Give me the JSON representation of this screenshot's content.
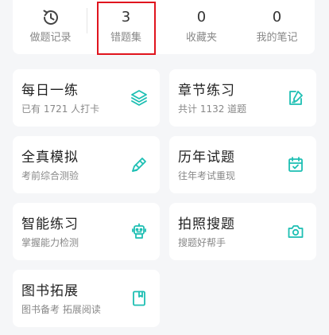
{
  "stats": {
    "record": {
      "label": "做题记录",
      "icon": "history-clock-icon"
    },
    "wrong": {
      "count": "3",
      "label": "错题集"
    },
    "favorites": {
      "count": "0",
      "label": "收藏夹"
    },
    "notes": {
      "count": "0",
      "label": "我的笔记"
    }
  },
  "tiles": [
    {
      "title": "每日一练",
      "subtitle": "已有 1721 人打卡",
      "icon": "layers-icon"
    },
    {
      "title": "章节练习",
      "subtitle": "共计 1132 道题",
      "icon": "edit-note-icon"
    },
    {
      "title": "全真模拟",
      "subtitle": "考前综合测验",
      "icon": "pencil-eraser-icon"
    },
    {
      "title": "历年试题",
      "subtitle": "往年考试重现",
      "icon": "calendar-check-icon"
    },
    {
      "title": "智能练习",
      "subtitle": "掌握能力检测",
      "icon": "robot-icon"
    },
    {
      "title": "拍照搜题",
      "subtitle": "搜题好帮手",
      "icon": "camera-icon"
    },
    {
      "title": "图书拓展",
      "subtitle": "图书备考 拓展阅读",
      "icon": "book-icon"
    }
  ],
  "colors": {
    "accent": "#1dbfb3",
    "highlight_border": "#e0141e"
  }
}
